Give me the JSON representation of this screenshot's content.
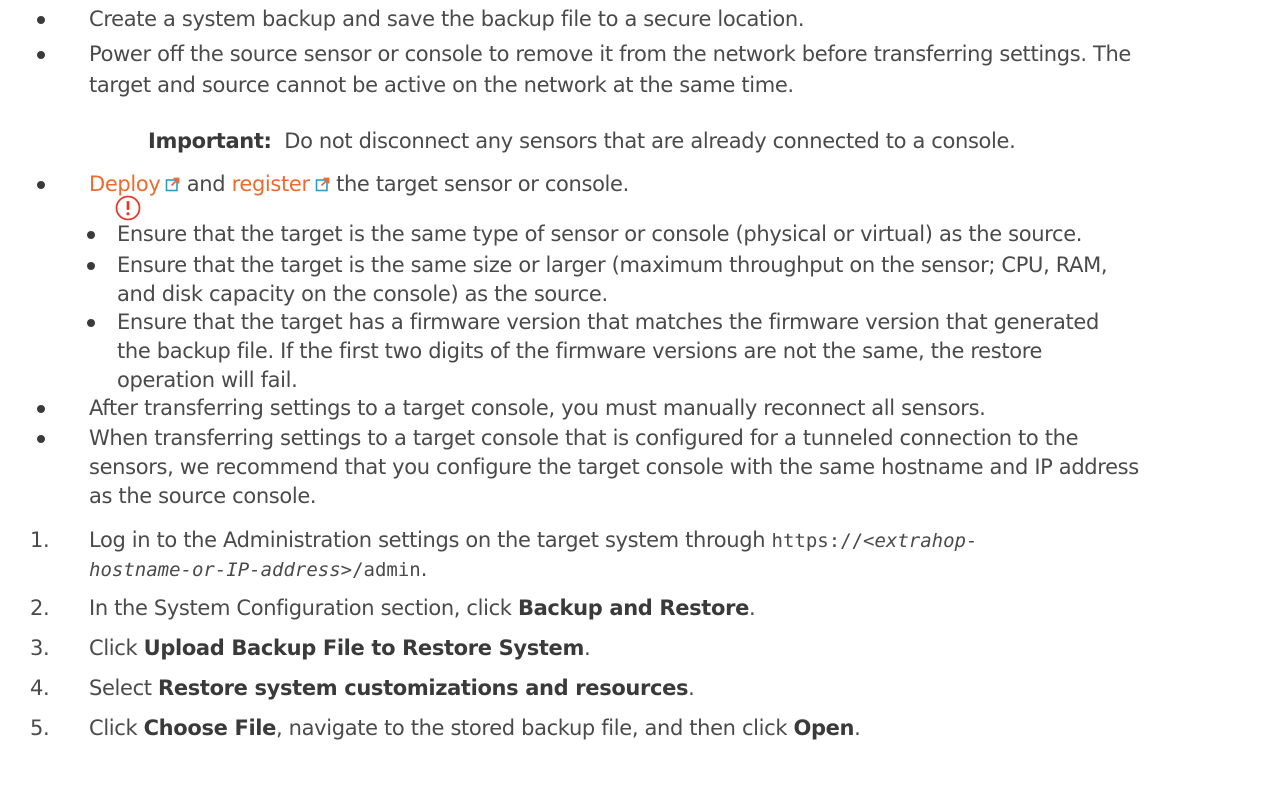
{
  "bullets_top": [
    {
      "text": "Create a system backup and save the backup file to a secure location."
    },
    {
      "text_line1": "Power off the source sensor or console to remove it from the network before transferring settings. The",
      "text_line2": "target and source cannot be active on the network at the same time."
    }
  ],
  "important": {
    "label": "Important:",
    "text": "Do not disconnect any sensors that are already connected to a console."
  },
  "deploy_bullet": {
    "link1": "Deploy",
    "and": "and",
    "link2": "register",
    "rest": "the target sensor or console."
  },
  "sub_bullets": [
    {
      "lines": [
        "Ensure that the target is the same type of sensor or console (physical or virtual) as the source."
      ]
    },
    {
      "lines": [
        "Ensure that the target is the same size or larger (maximum throughput on the sensor; CPU, RAM,",
        "and disk capacity on the console) as the source."
      ]
    },
    {
      "lines": [
        "Ensure that the target has a firmware version that matches the firmware version that generated",
        "the backup file. If the first two digits of the firmware versions are not the same, the restore",
        "operation will fail."
      ]
    }
  ],
  "bullets_bottom": [
    {
      "lines": [
        "After transferring settings to a target console, you must manually reconnect all sensors."
      ]
    },
    {
      "lines": [
        "When transferring settings to a target console that is configured for a tunneled connection to the",
        "sensors, we recommend that you configure the target console with the same hostname and IP address",
        "as the source console."
      ]
    }
  ],
  "steps": {
    "s1": {
      "num": "1.",
      "pre": "Log in to the Administration settings on the target system through",
      "code_a": "https://<",
      "code_var1": "extrahop-",
      "code_var2": "hostname-or-IP-address",
      "code_b": ">/admin",
      "post": "."
    },
    "s2": {
      "num": "2.",
      "pre": "In the System Configuration section, click",
      "bold": "Backup and Restore",
      "post": "."
    },
    "s3": {
      "num": "3.",
      "pre": "Click",
      "bold": "Upload Backup File to Restore System",
      "post": "."
    },
    "s4": {
      "num": "4.",
      "pre": "Select",
      "bold": "Restore system customizations and resources",
      "post": "."
    },
    "s5": {
      "num": "5.",
      "pre": "Click",
      "bold": "Choose File",
      "mid": ", navigate to the stored backup file, and then click",
      "bold2": "Open",
      "post": "."
    }
  },
  "colors": {
    "text": "#4a4a4a",
    "link": "#ec6b2d",
    "important_icon": "#e8392a",
    "external_link_icon": "#2a9ec4"
  },
  "icons": [
    "important-icon",
    "external-link-icon"
  ]
}
